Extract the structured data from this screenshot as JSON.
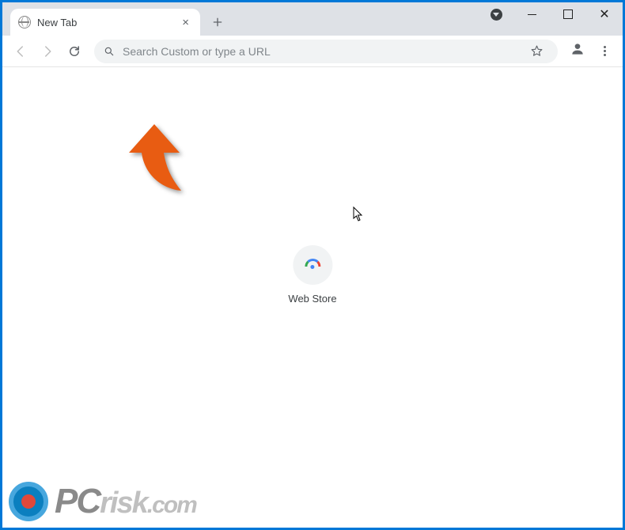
{
  "colors": {
    "frame_blue": "#0078d7",
    "tabstrip_bg": "#dee1e6",
    "omnibox_bg": "#f1f3f4",
    "anno_arrow": "#e85c12"
  },
  "tab": {
    "title": "New Tab"
  },
  "omnibox": {
    "placeholder": "Search Custom or type a URL",
    "value": ""
  },
  "shortcut": {
    "label": "Web Store"
  },
  "watermark": {
    "pc": "PC",
    "risk": "risk",
    "com": ".com"
  }
}
